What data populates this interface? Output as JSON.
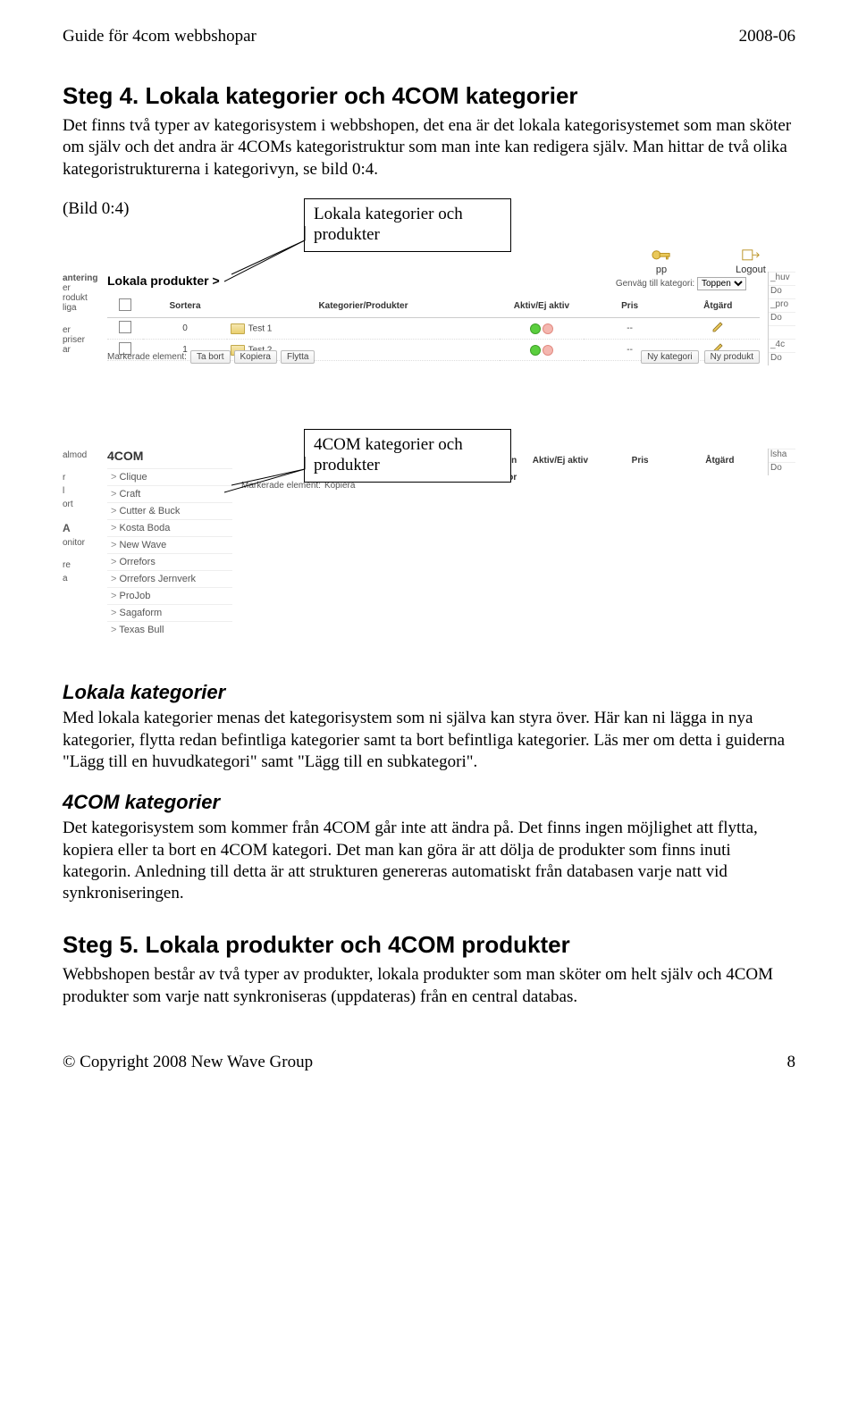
{
  "header": {
    "left": "Guide för 4com webbshopar",
    "right": "2008-06"
  },
  "footer": {
    "left": "© Copyright 2008 New Wave Group",
    "right": "8"
  },
  "step4": {
    "title": "Steg 4. Lokala kategorier och 4COM kategorier",
    "para": "Det finns två typer av kategorisystem i webbshopen, det ena är det lokala kategorisystemet som man sköter om själv och det andra är 4COMs kategoristruktur som man inte kan redigera själv. Man hittar de två olika kategoristrukturerna i kategorivyn, se bild 0:4.",
    "bild_label": "(Bild 0:4)"
  },
  "callouts": {
    "top": "Lokala kategorier och produkter",
    "bottom": "4COM kategorier och produkter"
  },
  "shot": {
    "topbar": {
      "home_label": "pp",
      "logout_label": "Logout"
    },
    "genvag": {
      "label": "Genväg till kategori:",
      "selected": "Toppen"
    },
    "local_head": "Lokala produkter >",
    "antering": "antering",
    "left_blocks": [
      [
        "er",
        "rodukt",
        "liga"
      ],
      [
        "er",
        "priser",
        "ar"
      ],
      [
        "almod"
      ],
      [
        "r",
        "l",
        "ort"
      ],
      [
        "A",
        "onitor"
      ],
      [
        "re",
        "a",
        ""
      ]
    ],
    "edge_rows": [
      "_huv",
      "Do",
      "_pro",
      "Do",
      "",
      "_4c",
      "Do",
      "",
      "lsha",
      "Do"
    ],
    "columns": {
      "sortera": "Sortera",
      "kat_prod": "Kategorier/Produkter",
      "aktiv": "Aktiv/Ej aktiv",
      "pris": "Pris",
      "atgard": "Åtgärd"
    },
    "rows": [
      {
        "sort": "0",
        "name": "Test 1",
        "pris": "--"
      },
      {
        "sort": "1",
        "name": "Test 2",
        "pris": "--"
      }
    ],
    "mark_label": "Markerade element:",
    "mark_buttons": [
      "Ta bort",
      "Kopiera",
      "Flytta"
    ],
    "new_buttons": [
      "Ny kategori",
      "Ny produkt"
    ],
    "fourcom_head": "4COM",
    "fcom_cols_extra": [
      "gen",
      "ntor"
    ],
    "fcom_mark_buttons": [
      "Kopiera"
    ],
    "brands": [
      "Clique",
      "Craft",
      "Cutter & Buck",
      "Kosta Boda",
      "New Wave",
      "Orrefors",
      "Orrefors Jernverk",
      "ProJob",
      "Sagaform",
      "Texas Bull"
    ]
  },
  "lokala": {
    "title": "Lokala kategorier",
    "para": "Med lokala kategorier menas det kategorisystem som ni själva kan styra över. Här kan ni lägga in nya kategorier, flytta redan befintliga kategorier samt ta bort befintliga kategorier. Läs mer om detta i guiderna \"Lägg till en huvudkategori\" samt \"Lägg till en subkategori\"."
  },
  "fourcom": {
    "title": "4COM kategorier",
    "para": "Det kategorisystem som kommer från 4COM går inte att ändra på. Det finns ingen möjlighet att flytta, kopiera eller ta bort en 4COM kategori. Det man kan göra är att dölja de produkter som finns inuti kategorin. Anledning till detta är att strukturen genereras automatiskt från databasen varje natt vid synkroniseringen."
  },
  "step5": {
    "title": "Steg 5. Lokala produkter och 4COM produkter",
    "para": "Webbshopen består av två typer av produkter, lokala produkter som man sköter om helt själv och 4COM produkter som varje natt synkroniseras (uppdateras) från en central databas."
  }
}
